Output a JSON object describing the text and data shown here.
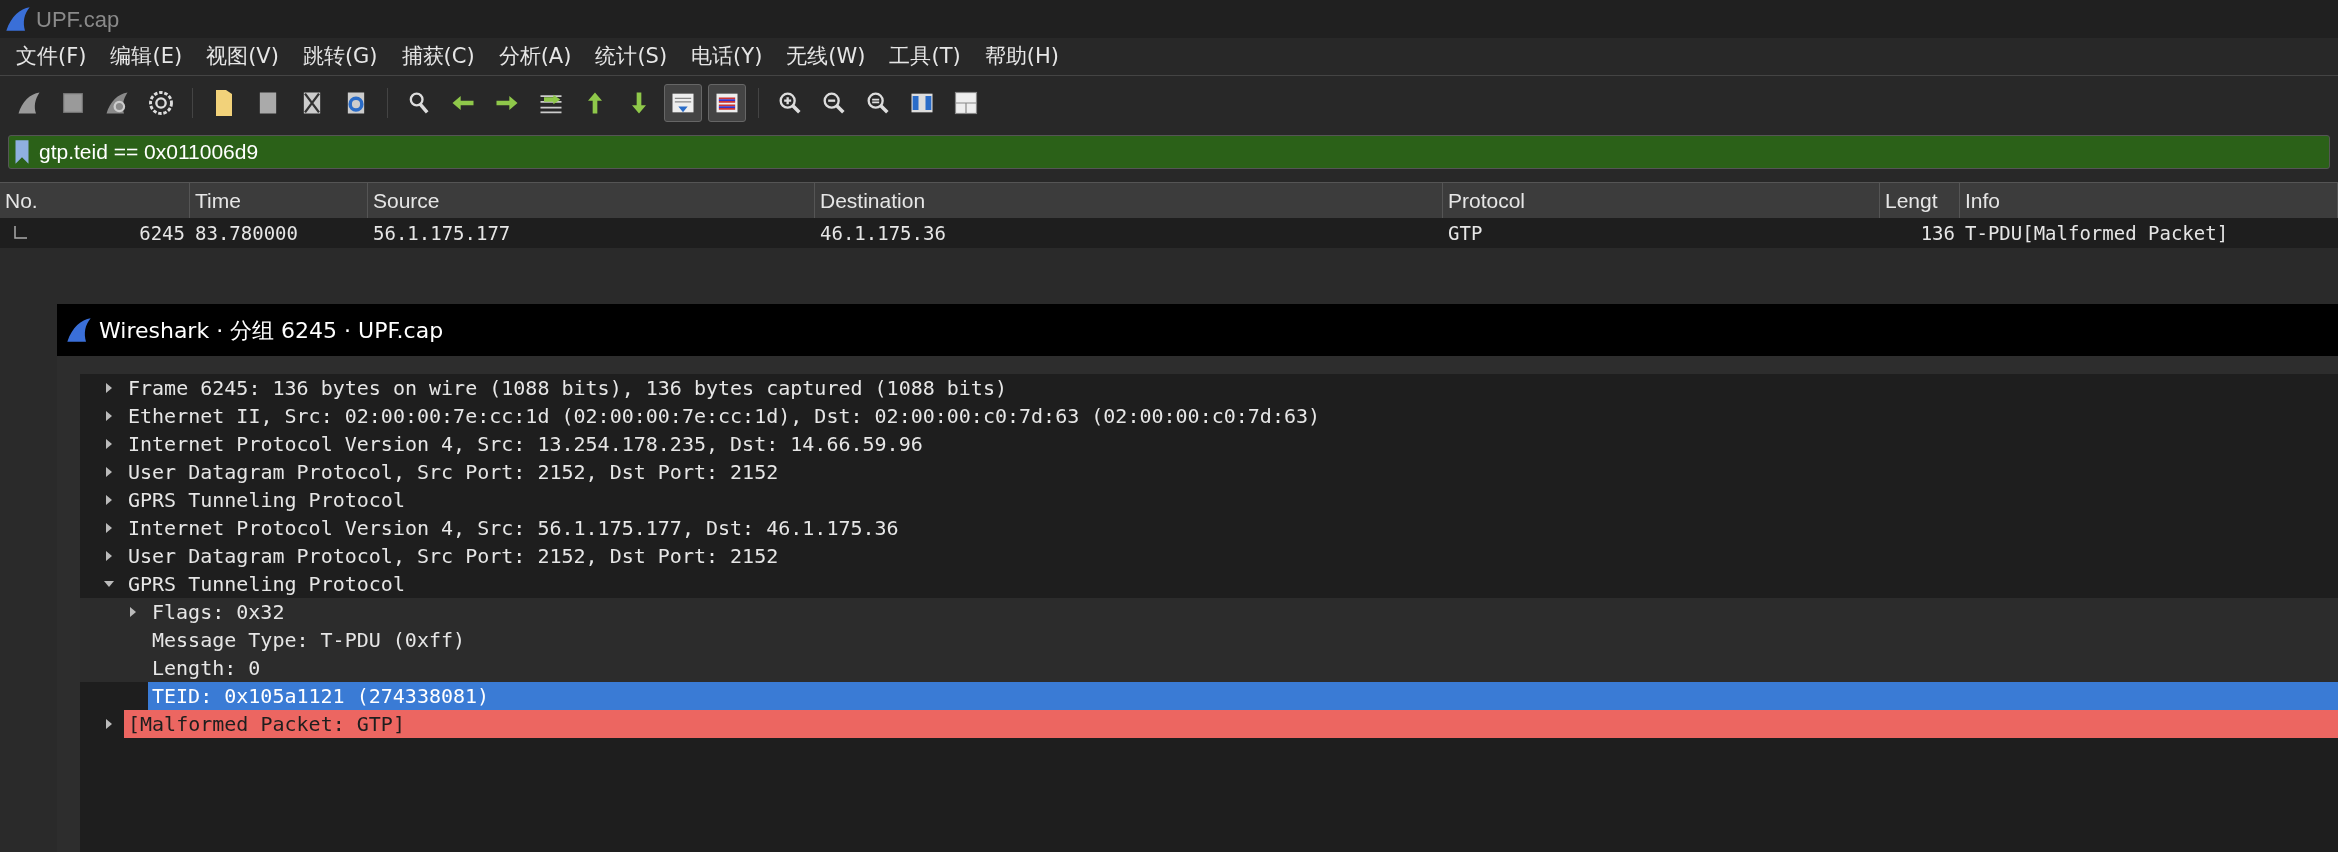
{
  "window": {
    "title": "UPF.cap"
  },
  "menu": [
    "文件(F)",
    "编辑(E)",
    "视图(V)",
    "跳转(G)",
    "捕获(C)",
    "分析(A)",
    "统计(S)",
    "电话(Y)",
    "无线(W)",
    "工具(T)",
    "帮助(H)"
  ],
  "toolbar": [
    {
      "on": false
    },
    {
      "on": false
    },
    {
      "on": false
    },
    {
      "on": false
    },
    {
      "on": false
    },
    {
      "on": false
    },
    {
      "on": false
    },
    {
      "on": false
    },
    {
      "on": false
    },
    {
      "on": false
    },
    {
      "on": false
    },
    {
      "on": false
    },
    {
      "on": false
    },
    {
      "on": false
    },
    {
      "on": true
    },
    {
      "on": true
    },
    {
      "on": false
    },
    {
      "on": false
    },
    {
      "on": false
    },
    {
      "on": false
    },
    {
      "on": false
    }
  ],
  "filter": {
    "value": "gtp.teid == 0x011006d9"
  },
  "packet_list": {
    "columns": [
      "No.",
      "Time",
      "Source",
      "Destination",
      "Protocol",
      "Lengt",
      "Info"
    ],
    "rows": [
      {
        "cells": [
          "6245",
          "83.780000",
          "56.1.175.177",
          "46.1.175.36",
          "GTP",
          "136",
          "T-PDU[Malformed Packet]"
        ]
      }
    ]
  },
  "dialog": {
    "title": "Wireshark · 分组 6245 · UPF.cap",
    "tree": [
      {
        "label": "Frame 6245: 136 bytes on wire (1088 bits), 136 bytes captured (1088 bits)",
        "expanded": false,
        "selected": false,
        "kind": "normal"
      },
      {
        "label": "Ethernet II, Src: 02:00:00:7e:cc:1d (02:00:00:7e:cc:1d), Dst: 02:00:00:c0:7d:63 (02:00:00:c0:7d:63)",
        "expanded": false,
        "selected": false,
        "kind": "normal"
      },
      {
        "label": "Internet Protocol Version 4, Src: 13.254.178.235, Dst: 14.66.59.96",
        "expanded": false,
        "selected": false,
        "kind": "normal"
      },
      {
        "label": "User Datagram Protocol, Src Port: 2152, Dst Port: 2152",
        "expanded": false,
        "selected": false,
        "kind": "normal"
      },
      {
        "label": "GPRS Tunneling Protocol",
        "expanded": false,
        "selected": false,
        "kind": "normal"
      },
      {
        "label": "Internet Protocol Version 4, Src: 56.1.175.177, Dst: 46.1.175.36",
        "expanded": false,
        "selected": false,
        "kind": "normal"
      },
      {
        "label": "User Datagram Protocol, Src Port: 2152, Dst Port: 2152",
        "expanded": false,
        "selected": false,
        "kind": "normal"
      },
      {
        "label": "GPRS Tunneling Protocol",
        "expanded": true,
        "selected": false,
        "kind": "normal",
        "children": [
          {
            "label": "Flags: 0x32",
            "expanded": false,
            "selected": false,
            "kind": "normal"
          },
          {
            "label": "Message Type: T-PDU (0xff)",
            "selected": false,
            "kind": "leaf"
          },
          {
            "label": "Length: 0",
            "selected": false,
            "kind": "leaf"
          },
          {
            "label": "TEID: 0x105a1121 (274338081)",
            "selected": true,
            "kind": "leaf"
          }
        ]
      },
      {
        "label": "[Malformed Packet: GTP]",
        "expanded": false,
        "selected": false,
        "kind": "error"
      }
    ]
  }
}
